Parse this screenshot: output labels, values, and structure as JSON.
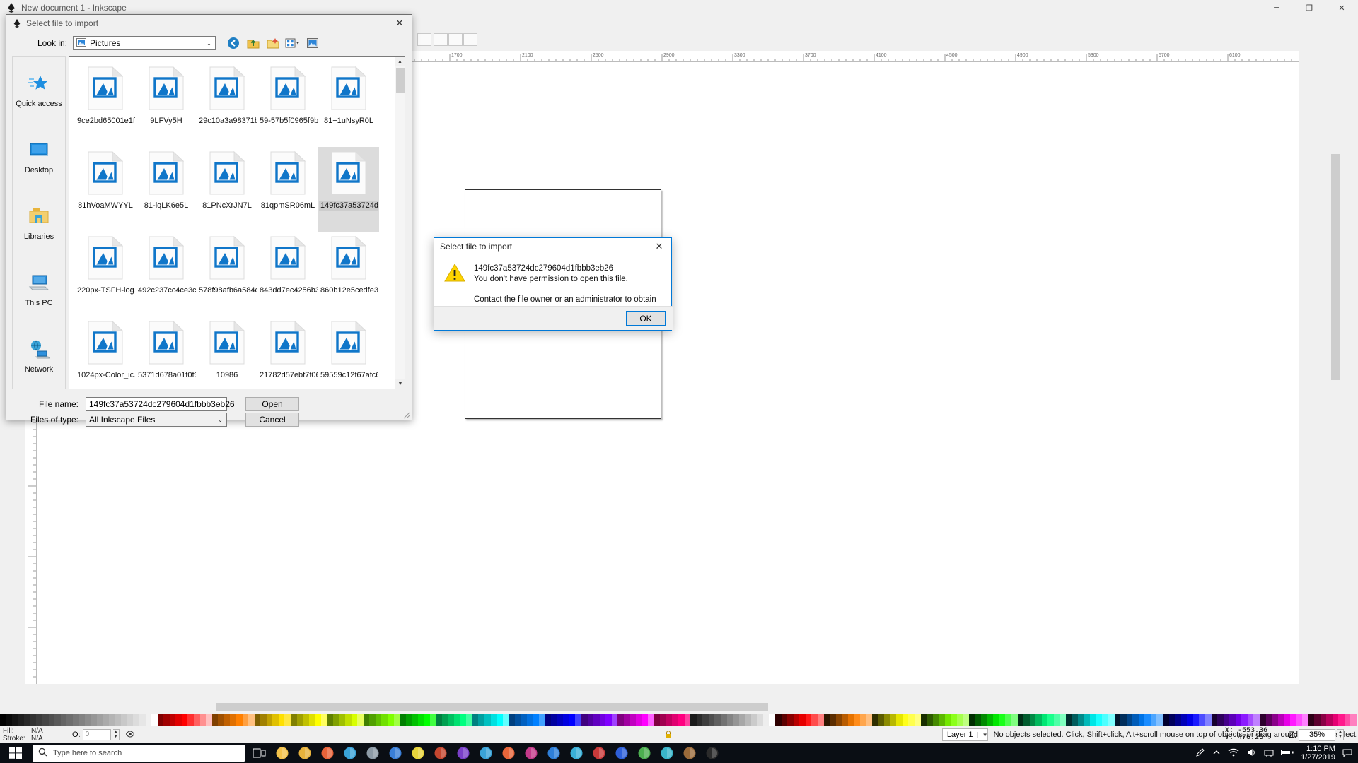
{
  "app": {
    "window_title": "New document 1 - Inkscape",
    "icon": "inkscape-icon",
    "minimize_label": "─",
    "maximize_label": "❐",
    "close_label": "✕"
  },
  "dialog": {
    "title": "Select file to import",
    "icon": "inkscape-icon",
    "close_label": "✕",
    "look_in_label": "Look in:",
    "look_in_value": "Pictures",
    "nav_buttons": [
      {
        "name": "back-button",
        "icon": "back-arrow-icon"
      },
      {
        "name": "up-one-level-button",
        "icon": "up-folder-icon"
      },
      {
        "name": "create-new-folder-button",
        "icon": "new-folder-icon"
      },
      {
        "name": "view-menu-button",
        "icon": "views-grid-icon"
      },
      {
        "name": "preview-pane-button",
        "icon": "preview-pane-icon"
      }
    ],
    "places": [
      {
        "label": "Quick access",
        "icon": "star-icon"
      },
      {
        "label": "Desktop",
        "icon": "desktop-icon"
      },
      {
        "label": "Libraries",
        "icon": "libraries-folder-icon"
      },
      {
        "label": "This PC",
        "icon": "computer-icon"
      },
      {
        "label": "Network",
        "icon": "network-icon"
      }
    ],
    "files": [
      {
        "name": "9ce2bd65001e1f...",
        "icon": "image-file-icon",
        "selected": false
      },
      {
        "name": "9LFVy5H",
        "icon": "image-file-icon",
        "selected": false
      },
      {
        "name": "29c10a3a98371b...",
        "icon": "image-file-icon",
        "selected": false
      },
      {
        "name": "59-57b5f0965f9b...",
        "icon": "image-file-icon",
        "selected": false
      },
      {
        "name": "81+1uNsyR0L",
        "icon": "image-file-icon",
        "selected": false
      },
      {
        "name": "81hVoaMWYYL",
        "icon": "image-file-icon",
        "selected": false
      },
      {
        "name": "81-lqLK6e5L",
        "icon": "image-file-icon",
        "selected": false
      },
      {
        "name": "81PNcXrJN7L",
        "icon": "image-file-icon",
        "selected": false
      },
      {
        "name": "81qpmSR06mL",
        "icon": "image-file-icon",
        "selected": false
      },
      {
        "name": "149fc37a53724dc...",
        "icon": "image-file-icon",
        "selected": true
      },
      {
        "name": "220px-TSFH-log...",
        "icon": "image-file-icon",
        "selected": false
      },
      {
        "name": "492c237cc4ce3c...",
        "icon": "image-file-icon",
        "selected": false
      },
      {
        "name": "578f98afb6a584c...",
        "icon": "image-file-icon",
        "selected": false
      },
      {
        "name": "843dd7ec4256b3...",
        "icon": "image-file-icon",
        "selected": false
      },
      {
        "name": "860b12e5cedfe38...",
        "icon": "image-file-icon",
        "selected": false
      },
      {
        "name": "1024px-Color_ic...",
        "icon": "image-file-icon",
        "selected": false
      },
      {
        "name": "5371d678a01f0f3...",
        "icon": "image-file-icon",
        "selected": false
      },
      {
        "name": "10986",
        "icon": "image-file-icon",
        "selected": false
      },
      {
        "name": "21782d57ebf7f06...",
        "icon": "image-file-icon",
        "selected": false
      },
      {
        "name": "59559c12f67afc6...",
        "icon": "image-file-icon",
        "selected": false
      }
    ],
    "file_name_label": "File name:",
    "file_name_value": "149fc37a53724dc279604d1fbbb3eb26",
    "files_of_type_label": "Files of type:",
    "files_of_type_value": "All Inkscape Files",
    "open_label": "Open",
    "cancel_label": "Cancel"
  },
  "messagebox": {
    "title": "Select file to import",
    "close_label": "✕",
    "icon": "warning-triangle-icon",
    "file_name": "149fc37a53724dc279604d1fbbb3eb26",
    "line1": "You don't have permission to open this file.",
    "line2": "Contact the file owner or an administrator to obtain permission.",
    "ok_label": "OK"
  },
  "statusbar": {
    "fill_label": "Fill:",
    "fill_value": "N/A",
    "stroke_label": "Stroke:",
    "stroke_value": "N/A",
    "opacity_label": "O:",
    "opacity_value": "0",
    "layer_name": "Layer 1",
    "message": "No objects selected. Click, Shift+click, Alt+scroll mouse on top of objects, or drag around objects to select.",
    "x_label": "X:",
    "x_value": "-553.36",
    "y_label": "Y:",
    "y_value": "476.25",
    "zoom_label": "Z:",
    "zoom_value": "35%"
  },
  "taskbar": {
    "start_icon": "windows-start-icon",
    "search_placeholder": "Type here to search",
    "search_icon": "search-icon",
    "items": [
      {
        "name": "taskview-icon"
      },
      {
        "name": "file-explorer-icon"
      },
      {
        "name": "folder-icon"
      },
      {
        "name": "firefox-icon"
      },
      {
        "name": "store-icon"
      },
      {
        "name": "calculator-icon"
      },
      {
        "name": "mail-icon"
      },
      {
        "name": "paint-icon"
      },
      {
        "name": "opera-icon"
      },
      {
        "name": "media-icon"
      },
      {
        "name": "chrome-icon"
      },
      {
        "name": "flame-icon"
      },
      {
        "name": "music-icon"
      },
      {
        "name": "blue-app-icon"
      },
      {
        "name": "edge-icon"
      },
      {
        "name": "record-icon"
      },
      {
        "name": "word-icon"
      },
      {
        "name": "green-app-icon"
      },
      {
        "name": "globe-icon"
      },
      {
        "name": "gimp-icon"
      },
      {
        "name": "inkscape-icon"
      }
    ],
    "tray": [
      {
        "name": "pen-tray-icon"
      },
      {
        "name": "chevron-up-icon"
      },
      {
        "name": "wifi-icon"
      },
      {
        "name": "volume-icon"
      },
      {
        "name": "network-tray-icon"
      },
      {
        "name": "battery-icon"
      }
    ],
    "clock_time": "1:10 PM",
    "clock_date": "1/27/2019",
    "notification_icon": "notification-icon"
  },
  "colors": {
    "accent": "#0078d7",
    "warning": "#ffd400",
    "file_blue": "#1076c9",
    "taskbar_bg": "#0a0e14"
  },
  "palette_colors": [
    "#000000",
    "#0a0a0a",
    "#141414",
    "#1e1e1e",
    "#282828",
    "#323232",
    "#3c3c3c",
    "#464646",
    "#505050",
    "#5a5a5a",
    "#646464",
    "#6e6e6e",
    "#787878",
    "#828282",
    "#8c8c8c",
    "#969696",
    "#a0a0a0",
    "#aaaaaa",
    "#b4b4b4",
    "#bebebe",
    "#c8c8c8",
    "#d2d2d2",
    "#dcdcdc",
    "#e6e6e6",
    "#f0f0f0",
    "#ffffff",
    "#800000",
    "#a00000",
    "#c00000",
    "#e00000",
    "#ff0000",
    "#ff3030",
    "#ff6060",
    "#ff9090",
    "#ffc0c0",
    "#804000",
    "#a05000",
    "#c06000",
    "#e07000",
    "#ff8000",
    "#ffa040",
    "#ffc080",
    "#806000",
    "#a08000",
    "#c0a000",
    "#e0c000",
    "#ffe000",
    "#ffe840",
    "#808000",
    "#a0a000",
    "#c0c000",
    "#e0e000",
    "#ffff00",
    "#ffff60",
    "#608000",
    "#80a000",
    "#a0c000",
    "#c0e000",
    "#d8ff00",
    "#e8ff60",
    "#408000",
    "#50a000",
    "#60c000",
    "#70e000",
    "#80ff00",
    "#a0ff40",
    "#008000",
    "#00a000",
    "#00c000",
    "#00e000",
    "#00ff00",
    "#40ff40",
    "#008040",
    "#00a050",
    "#00c060",
    "#00e070",
    "#00ff80",
    "#40ffa0",
    "#008080",
    "#00a0a0",
    "#00c0c0",
    "#00e0e0",
    "#00ffff",
    "#60ffff",
    "#004080",
    "#0050a0",
    "#0060c0",
    "#0070e0",
    "#0080ff",
    "#40a0ff",
    "#000080",
    "#0000a0",
    "#0000c0",
    "#0000e0",
    "#0000ff",
    "#4040ff",
    "#400080",
    "#5000a0",
    "#6000c0",
    "#7000e0",
    "#8000ff",
    "#a040ff",
    "#800080",
    "#a000a0",
    "#c000c0",
    "#e000e0",
    "#ff00ff",
    "#ff60ff",
    "#800040",
    "#a00050",
    "#c00060",
    "#e00070",
    "#ff0080",
    "#ff40a0",
    "#1a1a1a",
    "#2b2b2b",
    "#3d3d3d",
    "#4f4f4f",
    "#606060",
    "#727272",
    "#848484",
    "#959595",
    "#a7a7a7",
    "#b9b9b9",
    "#cbcbcb",
    "#dcdcdc",
    "#eeeeee",
    "#ffffff",
    "#2e0000",
    "#5c0000",
    "#8a0000",
    "#b80000",
    "#e60000",
    "#ff1a1a",
    "#ff4d4d",
    "#ff8080",
    "#2e1700",
    "#5c2e00",
    "#8a4500",
    "#b85c00",
    "#e67300",
    "#ff8c1a",
    "#ffa64d",
    "#ffbf80",
    "#2e2e00",
    "#5c5c00",
    "#8a8a00",
    "#b8b800",
    "#e6e600",
    "#ffff1a",
    "#ffff4d",
    "#ffff80",
    "#172e00",
    "#2e5c00",
    "#458a00",
    "#5cb800",
    "#73e600",
    "#8cff1a",
    "#a6ff4d",
    "#bfff80",
    "#002e00",
    "#005c00",
    "#008a00",
    "#00b800",
    "#00e600",
    "#1aff1a",
    "#4dff4d",
    "#80ff80",
    "#002e17",
    "#005c2e",
    "#008a45",
    "#00b85c",
    "#00e673",
    "#1aff8c",
    "#4dffa6",
    "#80ffbf",
    "#002e2e",
    "#005c5c",
    "#008a8a",
    "#00b8b8",
    "#00e6e6",
    "#1affff",
    "#4dffff",
    "#80ffff",
    "#00172e",
    "#002e5c",
    "#00458a",
    "#005cb8",
    "#0073e6",
    "#1a8cff",
    "#4da6ff",
    "#80bfff",
    "#00002e",
    "#00005c",
    "#00008a",
    "#0000b8",
    "#0000e6",
    "#1a1aff",
    "#4d4dff",
    "#8080ff",
    "#17002e",
    "#2e005c",
    "#45008a",
    "#5c00b8",
    "#7300e6",
    "#8c1aff",
    "#a64dff",
    "#bf80ff",
    "#2e002e",
    "#5c005c",
    "#8a008a",
    "#b800b8",
    "#e600e6",
    "#ff1aff",
    "#ff4dff",
    "#ff80ff",
    "#2e0017",
    "#5c002e",
    "#8a0045",
    "#b8005c",
    "#e60073",
    "#ff1a8c",
    "#ff4da6",
    "#ff80bf"
  ]
}
